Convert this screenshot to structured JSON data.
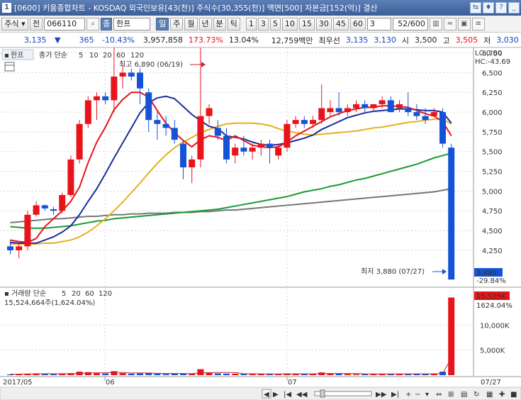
{
  "window": {
    "number": "1",
    "title": "[0600] 키움종합차트 - KOSDAQ 외국인보유[43(천)] 주식수[30,355(천)] 액면[500] 자본금[152(억)] 결산"
  },
  "toolbar": {
    "market": "주식",
    "period_toggle": "전",
    "code": "066110",
    "name_icon": "종",
    "name": "한프",
    "cycles": [
      "일",
      "주",
      "월",
      "년",
      "분",
      "틱"
    ],
    "selected_cycle": "일",
    "minutes": [
      "1",
      "3",
      "5",
      "10",
      "15",
      "30",
      "45",
      "60"
    ],
    "input_value": "3",
    "page": "52/600"
  },
  "info": {
    "price": "3,135",
    "arrow": "▼",
    "change": "365",
    "change_pct": "-10.43%",
    "volume": "3,957,858",
    "vol_ratio": "173.73%",
    "turnover": "13.04%",
    "amount": "12,759백만",
    "best_ask_label": "최우선",
    "best_ask": "3,135",
    "best_bid": "3,130",
    "open_label": "시",
    "open": "3,500",
    "high_label": "고",
    "high": "3,505",
    "low_label": "저",
    "low": "3,030"
  },
  "price_panel": {
    "stock_label": "한프",
    "indicator_label": "종가 단순",
    "periods": [
      "5",
      "10",
      "20",
      "60",
      "120"
    ],
    "lc_label": "LC:0.00",
    "hc_label": "HC:-43.69",
    "high_annot": "최고 6,890 (06/19)",
    "low_annot": "최저 3,880 (07/27)",
    "cur_price": "3,880",
    "cur_pct": "-29.84%"
  },
  "volume_panel": {
    "label": "거래량 단순",
    "periods": [
      "5",
      "20",
      "60",
      "120"
    ],
    "value_text": "15,524,664주(1,624.04%)",
    "cur_vol": "15,525K",
    "cur_pct": "1624.04%"
  },
  "x_axis": {
    "labels": [
      "2017/05",
      "06",
      "07"
    ],
    "right_label": "07/27"
  },
  "colors": {
    "up": "#e8141c",
    "down": "#1453d6",
    "ma5": "#e8141c",
    "ma10": "#1b2c9c",
    "ma20": "#e6b11e",
    "ma60": "#1a9a33",
    "ma120": "#777777"
  },
  "chart_data": {
    "type": "candlestick",
    "y_axis_ticks": [
      6750,
      6500,
      6250,
      6000,
      5750,
      5500,
      5250,
      5000,
      4750,
      4500,
      4250
    ],
    "volume_axis_ticks": [
      "10,000K",
      "5,000K"
    ],
    "candles": [
      [
        4300,
        4380,
        4200,
        4250
      ],
      [
        4250,
        4350,
        4150,
        4300
      ],
      [
        4300,
        4750,
        4250,
        4700
      ],
      [
        4700,
        4870,
        4680,
        4820
      ],
      [
        4820,
        4830,
        4750,
        4780
      ],
      [
        4770,
        4800,
        4700,
        4750
      ],
      [
        4750,
        4980,
        4720,
        4950
      ],
      [
        4950,
        5450,
        4920,
        5400
      ],
      [
        5400,
        5900,
        5350,
        5850
      ],
      [
        5850,
        6200,
        5800,
        6150
      ],
      [
        6150,
        6250,
        5900,
        6200
      ],
      [
        6200,
        6250,
        6100,
        6150
      ],
      [
        6150,
        6890,
        6000,
        6450
      ],
      [
        6450,
        6600,
        6300,
        6500
      ],
      [
        6500,
        6550,
        6400,
        6450
      ],
      [
        6500,
        6550,
        6100,
        6300
      ],
      [
        6250,
        6300,
        5750,
        5900
      ],
      [
        5900,
        6000,
        5650,
        5850
      ],
      [
        5850,
        5950,
        5700,
        5800
      ],
      [
        5800,
        5900,
        5600,
        5650
      ],
      [
        5600,
        5650,
        5150,
        5300
      ],
      [
        5300,
        5450,
        5100,
        5400
      ],
      [
        5400,
        6890,
        5300,
        5950
      ],
      [
        5950,
        6100,
        5850,
        6050
      ],
      [
        5800,
        5900,
        5650,
        5700
      ],
      [
        5700,
        5800,
        5350,
        5400
      ],
      [
        5450,
        5600,
        5350,
        5550
      ],
      [
        5550,
        5700,
        5450,
        5500
      ],
      [
        5500,
        5600,
        5400,
        5550
      ],
      [
        5550,
        5650,
        5450,
        5600
      ],
      [
        5600,
        5650,
        5350,
        5550
      ],
      [
        5450,
        5600,
        5400,
        5550
      ],
      [
        5550,
        5900,
        5500,
        5850
      ],
      [
        5850,
        5950,
        5800,
        5900
      ],
      [
        5900,
        5950,
        5800,
        5850
      ],
      [
        5850,
        5950,
        5800,
        5900
      ],
      [
        5900,
        6350,
        5850,
        6050
      ],
      [
        6000,
        6150,
        5950,
        6050
      ],
      [
        6050,
        6250,
        5950,
        6000
      ],
      [
        6000,
        6100,
        5950,
        6050
      ],
      [
        6050,
        6150,
        6000,
        6100
      ],
      [
        6100,
        6150,
        6000,
        6050
      ],
      [
        6050,
        6100,
        6000,
        6100
      ],
      [
        6100,
        6200,
        6050,
        6150
      ],
      [
        6150,
        6200,
        6000,
        6000
      ],
      [
        6050,
        6150,
        6000,
        6100
      ],
      [
        6050,
        6250,
        5950,
        6000
      ],
      [
        6000,
        6100,
        5900,
        5950
      ],
      [
        5950,
        6050,
        5850,
        5900
      ],
      [
        5950,
        6050,
        5950,
        6000
      ],
      [
        6000,
        6050,
        5550,
        5600
      ],
      [
        5550,
        5600,
        3880,
        3880
      ]
    ],
    "ma5": [
      4380,
      4360,
      4350,
      4400,
      4550,
      4650,
      4750,
      4870,
      5050,
      5360,
      5620,
      5810,
      6030,
      6160,
      6250,
      6250,
      6190,
      6020,
      5860,
      5740,
      5640,
      5560,
      5650,
      5700,
      5680,
      5640,
      5700,
      5640,
      5580,
      5560,
      5550,
      5560,
      5620,
      5700,
      5760,
      5820,
      5880,
      5940,
      5980,
      6020,
      6040,
      6060,
      6060,
      6080,
      6080,
      6070,
      6060,
      6020,
      5980,
      5950,
      5880,
      5700
    ],
    "ma10": [
      4350,
      4340,
      4340,
      4340,
      4380,
      4420,
      4480,
      4560,
      4700,
      4870,
      5030,
      5220,
      5420,
      5610,
      5800,
      5990,
      6120,
      6180,
      6200,
      6170,
      6070,
      5970,
      5890,
      5820,
      5790,
      5700,
      5680,
      5660,
      5620,
      5590,
      5580,
      5590,
      5610,
      5640,
      5670,
      5710,
      5780,
      5830,
      5880,
      5930,
      5960,
      5990,
      6010,
      6020,
      6030,
      6040,
      6040,
      6030,
      6020,
      6020,
      6000,
      5860
    ],
    "ma20": [
      4330,
      4330,
      4330,
      4330,
      4340,
      4340,
      4360,
      4380,
      4420,
      4480,
      4560,
      4650,
      4750,
      4860,
      4980,
      5100,
      5230,
      5350,
      5460,
      5550,
      5620,
      5680,
      5740,
      5780,
      5820,
      5850,
      5860,
      5860,
      5860,
      5850,
      5830,
      5790,
      5760,
      5740,
      5720,
      5710,
      5720,
      5730,
      5740,
      5750,
      5760,
      5780,
      5800,
      5810,
      5830,
      5850,
      5870,
      5880,
      5900,
      5910,
      5910,
      5850
    ],
    "ma60": [
      4550,
      4540,
      4530,
      4530,
      4530,
      4540,
      4550,
      4560,
      4580,
      4600,
      4620,
      4630,
      4650,
      4660,
      4670,
      4680,
      4690,
      4700,
      4710,
      4720,
      4730,
      4740,
      4750,
      4760,
      4770,
      4790,
      4810,
      4830,
      4850,
      4870,
      4890,
      4910,
      4930,
      4960,
      4990,
      5010,
      5030,
      5060,
      5080,
      5110,
      5140,
      5160,
      5190,
      5220,
      5250,
      5280,
      5310,
      5340,
      5380,
      5420,
      5450,
      5480
    ],
    "ma120": [
      4600,
      4610,
      4620,
      4630,
      4640,
      4650,
      4650,
      4660,
      4670,
      4680,
      4680,
      4690,
      4700,
      4700,
      4710,
      4710,
      4720,
      4720,
      4720,
      4730,
      4730,
      4730,
      4740,
      4740,
      4750,
      4760,
      4760,
      4770,
      4780,
      4790,
      4800,
      4810,
      4820,
      4830,
      4840,
      4850,
      4860,
      4870,
      4880,
      4890,
      4900,
      4910,
      4920,
      4930,
      4940,
      4950,
      4960,
      4970,
      4980,
      4990,
      5010,
      5030
    ],
    "volume_k": [
      150,
      200,
      300,
      350,
      250,
      200,
      250,
      400,
      700,
      600,
      400,
      350,
      800,
      400,
      300,
      350,
      450,
      300,
      250,
      300,
      350,
      300,
      1200,
      450,
      350,
      300,
      300,
      250,
      200,
      250,
      250,
      200,
      350,
      300,
      250,
      250,
      550,
      300,
      350,
      250,
      200,
      200,
      250,
      300,
      250,
      250,
      300,
      250,
      250,
      300,
      700,
      15525
    ],
    "volume_ma5": [
      200,
      210,
      230,
      260,
      280,
      280,
      300,
      300,
      350,
      420,
      470,
      490,
      570,
      510,
      450,
      440,
      450,
      380,
      330,
      330,
      330,
      300,
      480,
      520,
      530,
      540,
      530,
      290,
      280,
      260,
      250,
      240,
      250,
      270,
      270,
      270,
      340,
      330,
      340,
      340,
      330,
      260,
      250,
      240,
      240,
      240,
      250,
      270,
      260,
      270,
      360,
      3400
    ]
  }
}
